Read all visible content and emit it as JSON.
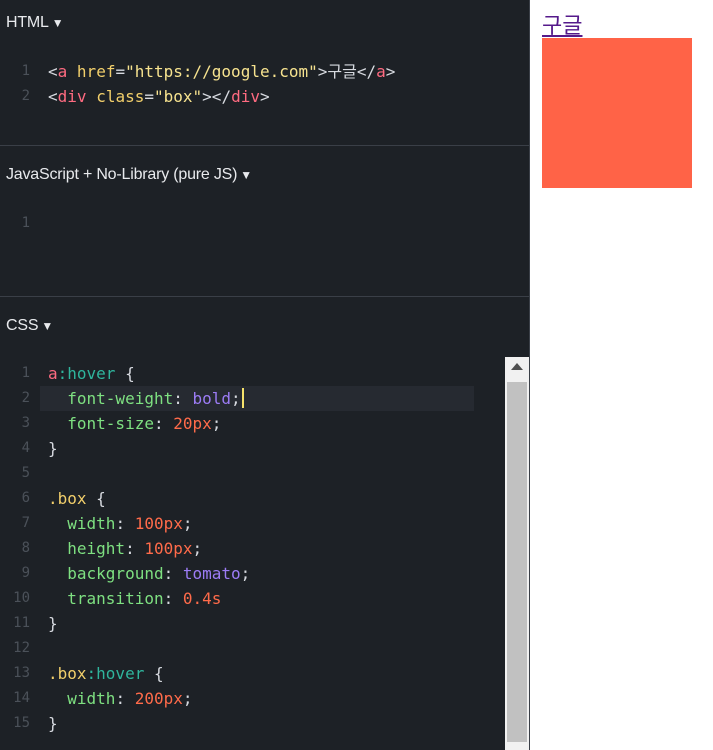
{
  "html_panel": {
    "title": "HTML",
    "lines": [
      {
        "n": "1",
        "parts": [
          [
            "c-punc",
            "<"
          ],
          [
            "c-tag",
            "a"
          ],
          [
            "c-punc",
            " "
          ],
          [
            "c-attr",
            "href"
          ],
          [
            "c-punc",
            "="
          ],
          [
            "c-str",
            "\"https://google.com\""
          ],
          [
            "c-punc",
            ">구글</"
          ],
          [
            "c-tag",
            "a"
          ],
          [
            "c-punc",
            ">"
          ]
        ]
      },
      {
        "n": "2",
        "parts": [
          [
            "c-punc",
            "<"
          ],
          [
            "c-tag",
            "div"
          ],
          [
            "c-punc",
            " "
          ],
          [
            "c-attr",
            "class"
          ],
          [
            "c-punc",
            "="
          ],
          [
            "c-str",
            "\"box\""
          ],
          [
            "c-punc",
            "></"
          ],
          [
            "c-tag",
            "div"
          ],
          [
            "c-punc",
            ">"
          ]
        ]
      }
    ]
  },
  "js_panel": {
    "title": "JavaScript + No-Library (pure JS)",
    "lines": [
      {
        "n": "1",
        "parts": []
      }
    ]
  },
  "css_panel": {
    "title": "CSS",
    "active_line": "2",
    "lines": [
      {
        "n": "1",
        "parts": [
          [
            "c-sel",
            "a"
          ],
          [
            "c-pseudo",
            ":hover"
          ],
          [
            "c-punc",
            " {"
          ]
        ]
      },
      {
        "n": "2",
        "parts": [
          [
            "c-punc",
            "  "
          ],
          [
            "c-prop",
            "font-weight"
          ],
          [
            "c-punc",
            ": "
          ],
          [
            "c-val-kw",
            "bold"
          ],
          [
            "c-punc",
            ";"
          ]
        ]
      },
      {
        "n": "3",
        "parts": [
          [
            "c-punc",
            "  "
          ],
          [
            "c-prop",
            "font-size"
          ],
          [
            "c-punc",
            ": "
          ],
          [
            "c-num",
            "20px"
          ],
          [
            "c-punc",
            ";"
          ]
        ]
      },
      {
        "n": "4",
        "parts": [
          [
            "c-punc",
            "}"
          ]
        ]
      },
      {
        "n": "5",
        "parts": []
      },
      {
        "n": "6",
        "parts": [
          [
            "c-cls",
            ".box"
          ],
          [
            "c-punc",
            " {"
          ]
        ]
      },
      {
        "n": "7",
        "parts": [
          [
            "c-punc",
            "  "
          ],
          [
            "c-prop",
            "width"
          ],
          [
            "c-punc",
            ": "
          ],
          [
            "c-num",
            "100px"
          ],
          [
            "c-punc",
            ";"
          ]
        ]
      },
      {
        "n": "8",
        "parts": [
          [
            "c-punc",
            "  "
          ],
          [
            "c-prop",
            "height"
          ],
          [
            "c-punc",
            ": "
          ],
          [
            "c-num",
            "100px"
          ],
          [
            "c-punc",
            ";"
          ]
        ]
      },
      {
        "n": "9",
        "parts": [
          [
            "c-punc",
            "  "
          ],
          [
            "c-prop",
            "background"
          ],
          [
            "c-punc",
            ": "
          ],
          [
            "c-val-kw",
            "tomato"
          ],
          [
            "c-punc",
            ";"
          ]
        ]
      },
      {
        "n": "10",
        "parts": [
          [
            "c-punc",
            "  "
          ],
          [
            "c-prop",
            "transition"
          ],
          [
            "c-punc",
            ": "
          ],
          [
            "c-num",
            "0.4s"
          ]
        ]
      },
      {
        "n": "11",
        "parts": [
          [
            "c-punc",
            "}"
          ]
        ]
      },
      {
        "n": "12",
        "parts": []
      },
      {
        "n": "13",
        "parts": [
          [
            "c-cls",
            ".box"
          ],
          [
            "c-pseudo",
            ":hover"
          ],
          [
            "c-punc",
            " {"
          ]
        ]
      },
      {
        "n": "14",
        "parts": [
          [
            "c-punc",
            "  "
          ],
          [
            "c-prop",
            "width"
          ],
          [
            "c-punc",
            ": "
          ],
          [
            "c-num",
            "200px"
          ],
          [
            "c-punc",
            ";"
          ]
        ]
      },
      {
        "n": "15",
        "parts": [
          [
            "c-punc",
            "}"
          ]
        ]
      }
    ]
  },
  "preview": {
    "link_text": "구글",
    "box_color": "#ff6347"
  },
  "colors": {
    "editor_bg": "#1d2126",
    "preview_bg": "#ffffff",
    "link_color": "#551a8b"
  }
}
